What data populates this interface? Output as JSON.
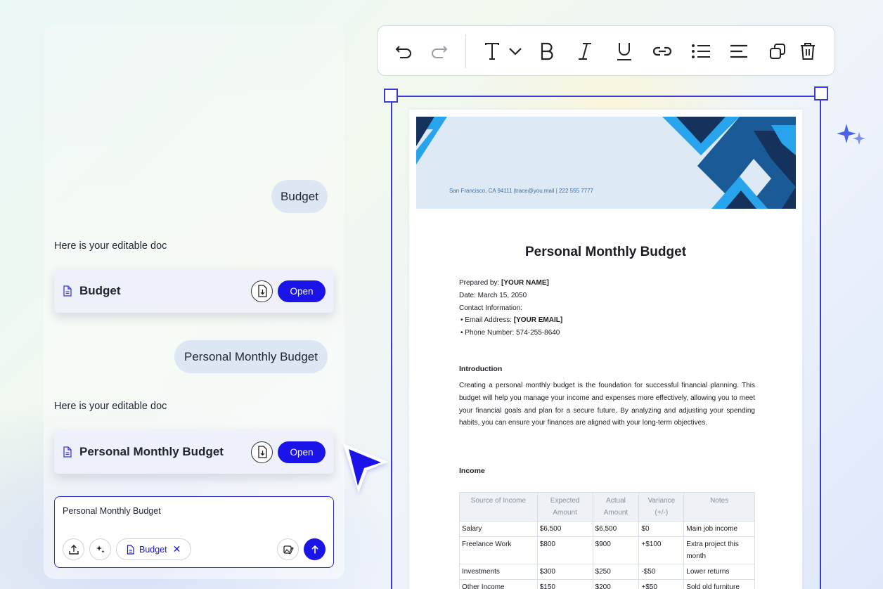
{
  "chat": {
    "user_message_1": "Budget",
    "assistant_text_1": "Here is your editable doc",
    "doc_card_1": {
      "title": "Budget",
      "open_label": "Open"
    },
    "user_message_2": "Personal Monthly Budget",
    "assistant_text_2": "Here is your editable doc",
    "doc_card_2": {
      "title": "Personal Monthly Budget",
      "open_label": "Open"
    }
  },
  "composer": {
    "input_value": "Personal Monthly Budget",
    "attachment_chip": "Budget",
    "icons": [
      "upload-icon",
      "sparkle-icon",
      "document-icon",
      "close-icon",
      "image-edit-icon",
      "arrow-up-icon"
    ]
  },
  "toolbar": {
    "icons": [
      "undo-icon",
      "redo-icon",
      "text-style-icon",
      "chevron-down-icon",
      "bold-icon",
      "italic-icon",
      "underline-icon",
      "link-icon",
      "bullet-list-icon",
      "align-left-icon",
      "duplicate-icon",
      "delete-icon"
    ]
  },
  "document": {
    "header_address": "San Francisco, CA 94111 |trace@you.mail | 222 555 7777",
    "title": "Personal Monthly Budget",
    "prepared_by_label": "Prepared by:",
    "prepared_by_value": "[YOUR NAME]",
    "date": "Date: March 15, 2050",
    "contact_label": "Contact Information:",
    "email_label": "• Email Address:",
    "email_value": "[YOUR EMAIL]",
    "phone": "• Phone Number: 574-255-8640",
    "intro_heading": "Introduction",
    "intro_text": "Creating a personal monthly budget is the foundation for successful financial planning. This budget will help you manage your income and expenses more effectively, allowing you to meet your financial goals and plan for a secure future. By analyzing and adjusting your spending habits, you can ensure your finances are aligned with your long-term objectives.",
    "income_heading": "Income",
    "income_table": {
      "headers": [
        "Source of Income",
        "Expected Amount",
        "Actual Amount",
        "Variance (+/-)",
        "Notes"
      ],
      "rows": [
        [
          "Salary",
          "$6,500",
          "$6,500",
          "$0",
          "Main job income"
        ],
        [
          "Freelance Work",
          "$800",
          "$900",
          "+$100",
          "Extra project this month"
        ],
        [
          "Investments",
          "$300",
          "$250",
          "-$50",
          "Lower returns"
        ],
        [
          "Other Income",
          "$150",
          "$200",
          "+$50",
          "Sold old furniture"
        ]
      ]
    }
  },
  "colors": {
    "accent": "#1a14e8",
    "selection": "#3b3bd4",
    "header_dark": "#14325c",
    "header_mid": "#1a5a96",
    "header_light": "#28a4ec"
  }
}
